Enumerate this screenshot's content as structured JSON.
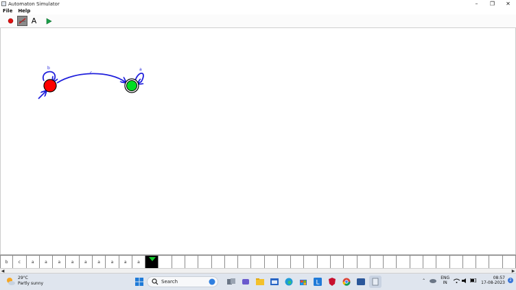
{
  "window": {
    "title": "Automaton Simulator"
  },
  "menu": {
    "file": "File",
    "help": "Help"
  },
  "toolbar": {
    "text_tool": "A"
  },
  "automaton": {
    "states": [
      {
        "id": "q0",
        "kind": "start",
        "color": "#ff0000"
      },
      {
        "id": "q1",
        "kind": "accepting",
        "color": "#00dd22"
      }
    ],
    "transitions": [
      {
        "from": "q0",
        "to": "q0",
        "symbol": "b"
      },
      {
        "from": "q0",
        "to": "q1",
        "symbol": "c"
      },
      {
        "from": "q1",
        "to": "q1",
        "symbol": "a"
      }
    ],
    "edge_color": "#1e1edc"
  },
  "tape": {
    "cells": [
      "b",
      "c",
      "a",
      "a",
      "a",
      "a",
      "a",
      "a",
      "a",
      "a",
      "a",
      "",
      "",
      "",
      "",
      "",
      "",
      "",
      "",
      "",
      "",
      "",
      "",
      "",
      "",
      "",
      "",
      "",
      "",
      "",
      "",
      "",
      "",
      "",
      "",
      "",
      "",
      "",
      ""
    ],
    "head_index": 11
  },
  "taskbar": {
    "weather_temp": "29°C",
    "weather_desc": "Partly sunny",
    "search_label": "Search",
    "lang_1": "ENG",
    "lang_2": "IN",
    "time": "08:57",
    "date": "17-08-2023",
    "notification_count": "2"
  }
}
